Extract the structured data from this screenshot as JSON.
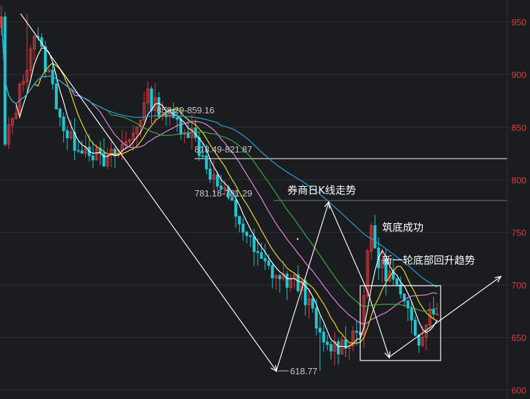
{
  "chart_data": {
    "type": "candlestick",
    "title": "",
    "ylim": [
      600,
      960
    ],
    "yticks": [
      600,
      650,
      700,
      750,
      800,
      850,
      900,
      950
    ],
    "grid": true,
    "colors": {
      "background": "#1b1c20",
      "grid": "#2e3036",
      "up": "#e03c3c",
      "down": "#1fc7d4",
      "tick_label": "#e03c3c",
      "annotation": "#ffffff",
      "level_label": "#c9c9c9"
    },
    "price_range": {
      "start": 955,
      "high": 958,
      "low": 618.77,
      "end": 680
    },
    "moving_averages": [
      {
        "period": 5,
        "color": "#ffffff"
      },
      {
        "period": 10,
        "color": "#f5e11a"
      },
      {
        "period": 20,
        "color": "#e58be3"
      },
      {
        "period": 30,
        "color": "#3fae46"
      },
      {
        "period": 60,
        "color": "#29a3e0"
      }
    ],
    "levels": [
      {
        "label": "858.29-859.16",
        "value": 858.7,
        "line": false
      },
      {
        "label": "818.49-821.87",
        "value": 820,
        "line": true
      },
      {
        "label": "781.18-781.29",
        "value": 781.2,
        "line": true
      }
    ],
    "low_label": "618.77",
    "annotations": [
      {
        "text": "券商日K线走势"
      },
      {
        "text": "筑底成功"
      },
      {
        "text": "新一轮底部回升趋势"
      }
    ]
  }
}
